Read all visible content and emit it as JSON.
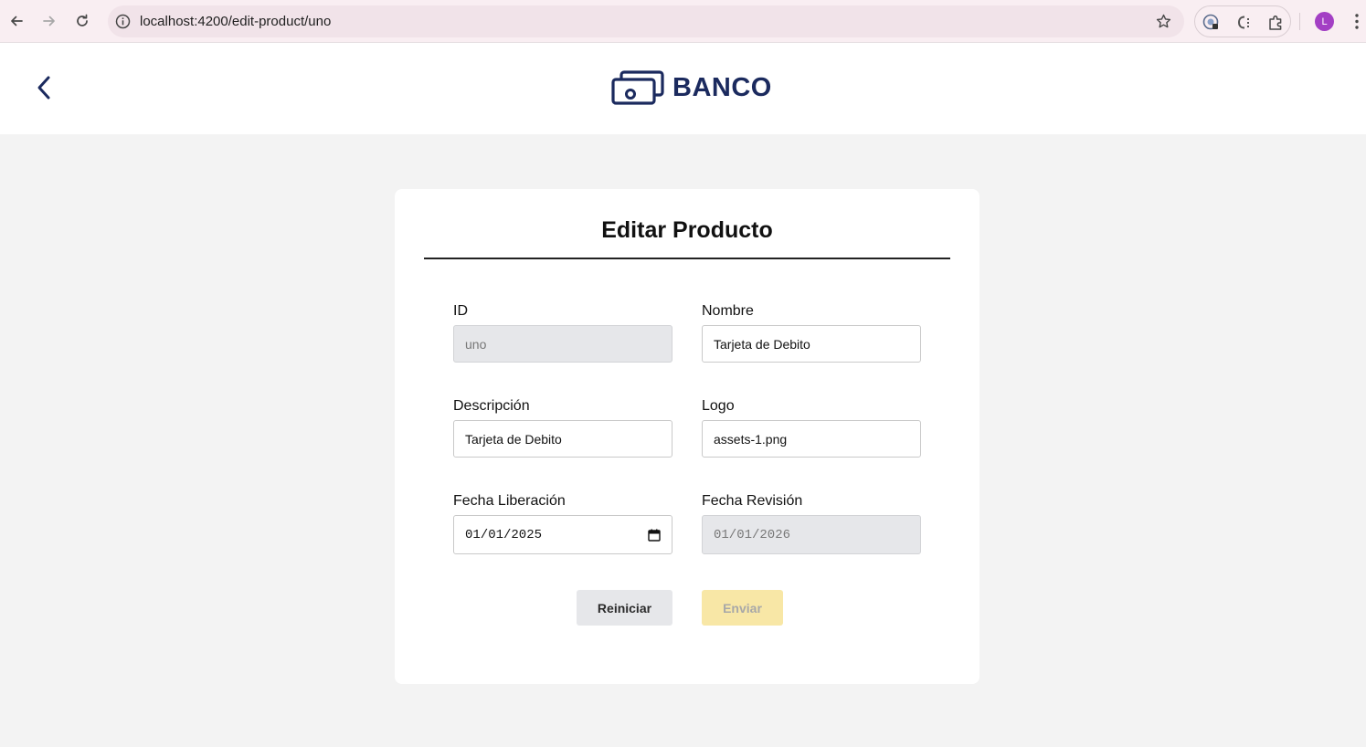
{
  "browser": {
    "url": "localhost:4200/edit-product/uno",
    "profile_initial": "L"
  },
  "header": {
    "brand_name": "BANCO"
  },
  "form": {
    "title": "Editar Producto",
    "fields": {
      "id": {
        "label": "ID",
        "value": "uno",
        "disabled": true
      },
      "nombre": {
        "label": "Nombre",
        "value": "Tarjeta de Debito"
      },
      "descripcion": {
        "label": "Descripción",
        "value": "Tarjeta de Debito"
      },
      "logo": {
        "label": "Logo",
        "value": "assets-1.png"
      },
      "fecha_liberacion": {
        "label": "Fecha Liberación",
        "value": "01/01/2025"
      },
      "fecha_revision": {
        "label": "Fecha Revisión",
        "value": "01/01/2026",
        "disabled": true
      }
    },
    "buttons": {
      "reset_label": "Reiniciar",
      "submit_label": "Enviar"
    }
  },
  "colors": {
    "brand": "#1b2a5e",
    "submit_disabled_bg": "#f8e7a6",
    "disabled_input_bg": "#e6e7ea",
    "page_bg": "#f3f3f3"
  }
}
